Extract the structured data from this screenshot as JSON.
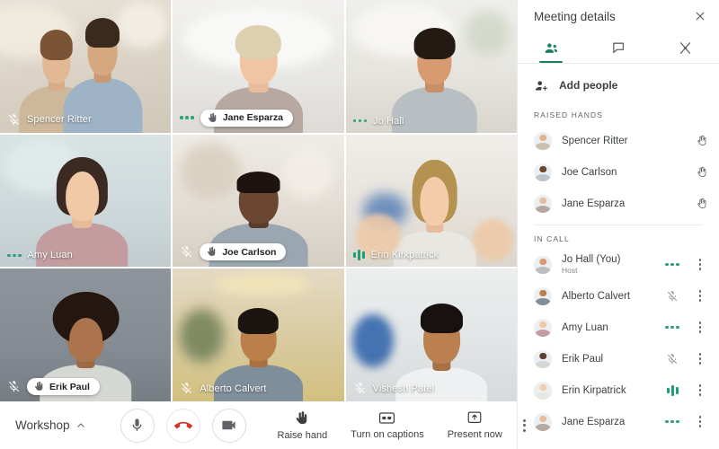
{
  "panel": {
    "title": "Meeting details",
    "close_icon": "close-icon",
    "tabs": [
      {
        "name": "people",
        "icon": "people-icon",
        "active": true
      },
      {
        "name": "chat",
        "icon": "chat-icon",
        "active": false
      },
      {
        "name": "activities",
        "icon": "activities-icon",
        "active": false
      }
    ],
    "add_people": {
      "label": "Add people",
      "icon": "add-person-icon"
    },
    "sections": [
      {
        "id": "raised-hands",
        "header": "RAISED HANDS",
        "people": [
          {
            "name": "Spencer Ritter",
            "state": "hand-raised"
          },
          {
            "name": "Joe Carlson",
            "state": "hand-raised"
          },
          {
            "name": "Jane Esparza",
            "state": "hand-raised"
          }
        ]
      },
      {
        "id": "in-call",
        "header": "IN CALL",
        "people": [
          {
            "name": "Jo Hall (You)",
            "sub": "Host",
            "state": "speaking-dots"
          },
          {
            "name": "Alberto Calvert",
            "sub": "",
            "state": "muted"
          },
          {
            "name": "Amy Luan",
            "sub": "",
            "state": "speaking-dots"
          },
          {
            "name": "Erik Paul",
            "sub": "",
            "state": "muted"
          },
          {
            "name": "Erin Kirpatrick",
            "sub": "",
            "state": "speaking-bars"
          },
          {
            "name": "Jane Esparza",
            "sub": "",
            "state": "speaking-dots"
          }
        ]
      }
    ]
  },
  "stage": {
    "tiles": [
      {
        "name": "Spencer Ritter",
        "state": "muted",
        "hand": false
      },
      {
        "name": "Jane Esparza",
        "state": "speaking-dots",
        "hand": true
      },
      {
        "name": "Jo Hall",
        "state": "speaking-dots",
        "hand": false
      },
      {
        "name": "Amy Luan",
        "state": "speaking-dots",
        "hand": false
      },
      {
        "name": "Joe Carlson",
        "state": "muted",
        "hand": true
      },
      {
        "name": "Erin Kirkpatrick",
        "state": "speaking-bars",
        "hand": false
      },
      {
        "name": "Erik Paul",
        "state": "muted",
        "hand": true
      },
      {
        "name": "Alberto Calvert",
        "state": "muted",
        "hand": false
      },
      {
        "name": "Vishesh Patel",
        "state": "muted",
        "hand": false
      }
    ]
  },
  "toolbar": {
    "meeting_name": "Workshop",
    "expand_icon": "chevron-up-icon",
    "security_icon": "shield-lock-icon",
    "mic_button": "microphone-icon",
    "leave_button": "end-call-icon",
    "camera_button": "camera-icon",
    "actions": [
      {
        "label": "Raise hand",
        "icon": "hand-icon"
      },
      {
        "label": "Turn on captions",
        "icon": "closed-captions-icon"
      },
      {
        "label": "Present now",
        "icon": "present-screen-icon"
      }
    ],
    "more_icon": "more-options-icon"
  },
  "colors": {
    "accent_green": "#1a7f5a",
    "speaking_green": "#2e9e7d",
    "end_call_red": "#d93025",
    "shield_blue": "#4285f4",
    "text_primary": "#3c4043",
    "text_secondary": "#5f6368"
  }
}
